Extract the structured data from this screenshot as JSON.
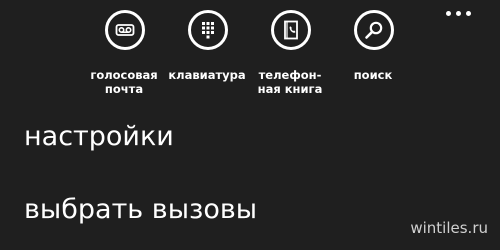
{
  "app_bar": {
    "buttons": [
      {
        "label": "голосовая\nпочта",
        "icon": "voicemail-icon"
      },
      {
        "label": "клавиатура",
        "icon": "keypad-icon"
      },
      {
        "label": "телефон-\nная книга",
        "icon": "phonebook-icon"
      },
      {
        "label": "поиск",
        "icon": "search-icon"
      }
    ],
    "more_icon": "more-dots-icon"
  },
  "menu": {
    "items": [
      {
        "label": "настройки"
      },
      {
        "label": "выбрать вызовы"
      }
    ]
  },
  "watermark": "wintiles.ru"
}
